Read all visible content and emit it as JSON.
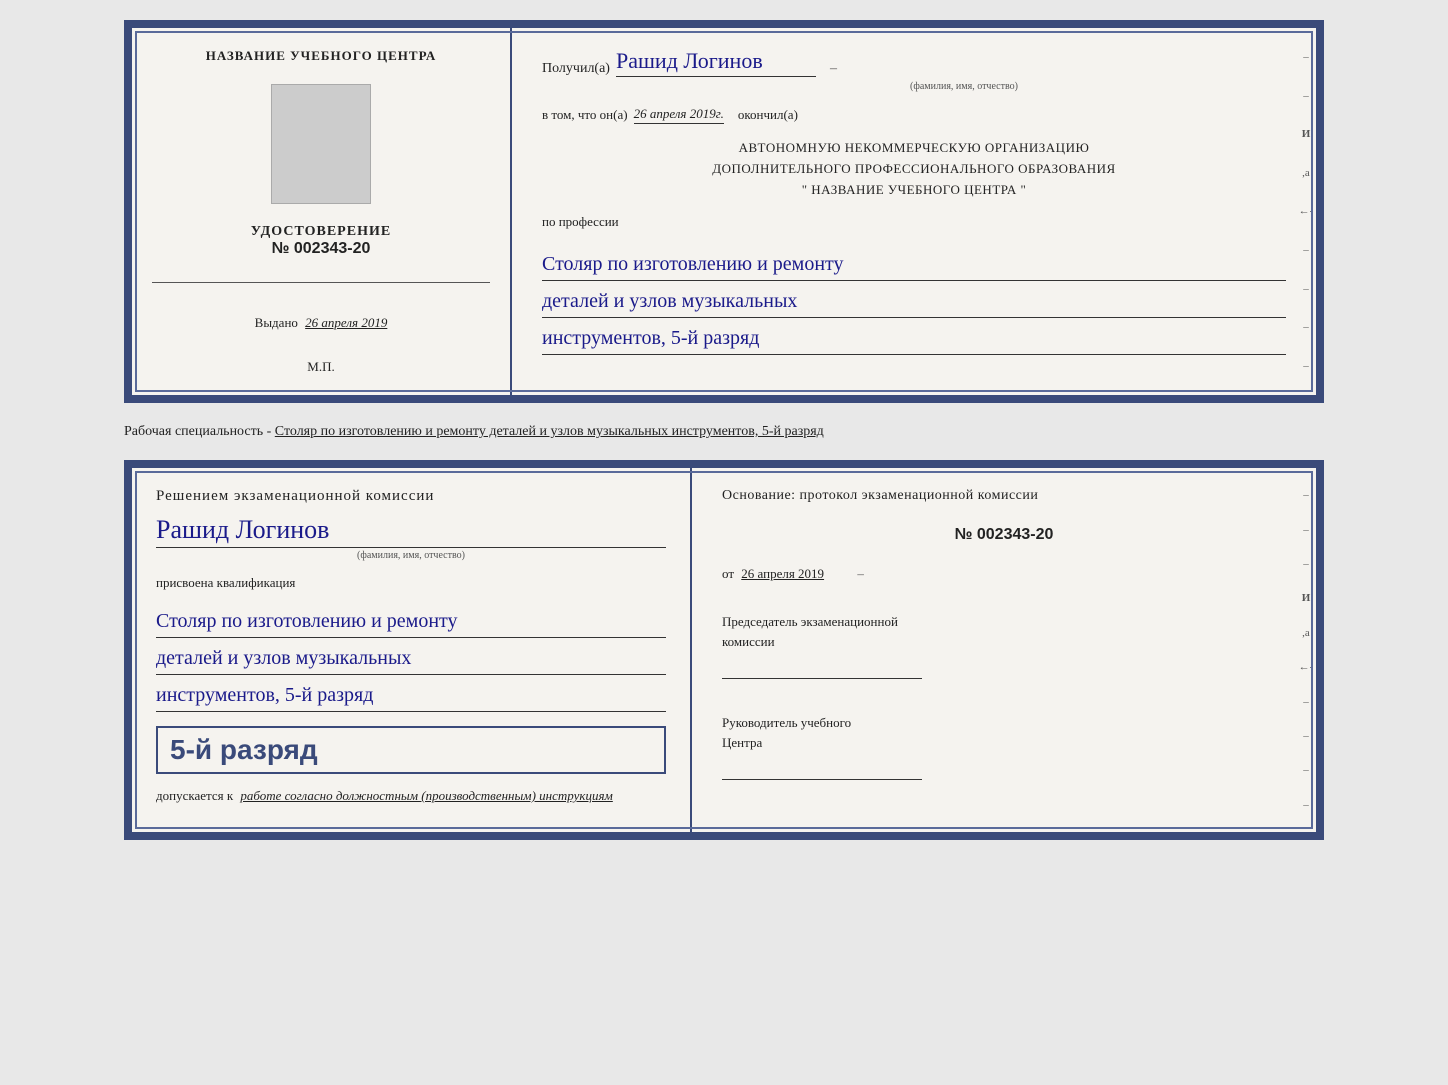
{
  "top_cert": {
    "left": {
      "school_title": "НАЗВАНИЕ УЧЕБНОГО ЦЕНТРА",
      "udostoverenie": "УДОСТОВЕРЕНИЕ",
      "number": "№ 002343-20",
      "vydano_label": "Выдано",
      "vydano_date": "26 апреля 2019",
      "mp": "М.П."
    },
    "right": {
      "poluchil_label": "Получил(а)",
      "name": "Рашид Логинов",
      "fio_hint": "(фамилия, имя, отчество)",
      "vtom_label": "в том, что он(а)",
      "date_value": "26 апреля 2019г.",
      "okonchil": "окончил(а)",
      "org_line1": "АВТОНОМНУЮ НЕКОММЕРЧЕСКУЮ ОРГАНИЗАЦИЮ",
      "org_line2": "ДОПОЛНИТЕЛЬНОГО ПРОФЕССИОНАЛЬНОГО ОБРАЗОВАНИЯ",
      "org_line3": "\"  НАЗВАНИЕ УЧЕБНОГО ЦЕНТРА  \"",
      "po_professii": "по профессии",
      "profession_line1": "Столяр по изготовлению и ремонту",
      "profession_line2": "деталей и узлов музыкальных",
      "profession_line3": "инструментов, 5-й разряд"
    }
  },
  "description": "Рабочая специальность - Столяр по изготовлению и ремонту деталей и узлов музыкальных инструментов, 5-й разряд",
  "bottom_cert": {
    "left": {
      "resheniem": "Решением экзаменационной комиссии",
      "name": "Рашид Логинов",
      "fio_hint": "(фамилия, имя, отчество)",
      "prisvoena": "присвоена квалификация",
      "qualification_line1": "Столяр по изготовлению и ремонту",
      "qualification_line2": "деталей и узлов музыкальных",
      "qualification_line3": "инструментов, 5-й разряд",
      "bold_rank": "5-й разряд",
      "dopuskaetsya_label": "допускается к",
      "dopuskaetsya_value": "работе согласно должностным (производственным) инструкциям"
    },
    "right": {
      "osnovanie": "Основание: протокол экзаменационной комиссии",
      "number": "№  002343-20",
      "ot_label": "от",
      "ot_date": "26 апреля 2019",
      "predsedatel_line1": "Председатель экзаменационной",
      "predsedatel_line2": "комиссии",
      "rukovoditel_line1": "Руководитель учебного",
      "rukovoditel_line2": "Центра"
    }
  }
}
